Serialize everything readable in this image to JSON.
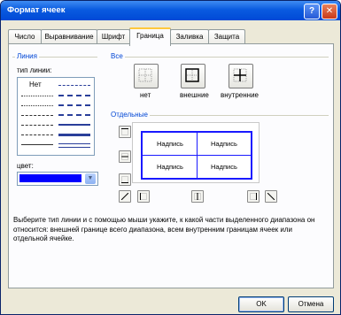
{
  "window": {
    "title": "Формат ячеек",
    "help_glyph": "?",
    "close_glyph": "✕"
  },
  "tabs": [
    {
      "label": "Число"
    },
    {
      "label": "Выравнивание"
    },
    {
      "label": "Шрифт"
    },
    {
      "label": "Граница",
      "active": true
    },
    {
      "label": "Заливка"
    },
    {
      "label": "Защита"
    }
  ],
  "line_group": {
    "legend": "Линия",
    "type_label": "тип линии:",
    "none_label": "Нет",
    "color_label": "цвет:",
    "color_value": "#0000ff"
  },
  "all_group": {
    "legend": "Все",
    "presets": [
      {
        "label": "нет",
        "icon": "border-none-icon"
      },
      {
        "label": "внешние",
        "icon": "border-outline-icon"
      },
      {
        "label": "внутренние",
        "icon": "border-inside-icon"
      }
    ]
  },
  "separate_group": {
    "legend": "Отдельные",
    "preview_cells": [
      "Надпись",
      "Надпись",
      "Надпись",
      "Надпись"
    ]
  },
  "description": "Выберите тип линии и с помощью мыши укажите, к какой части выделенного диапазона он относится: внешней границе всего диапазона, всем внутренним границам ячеек или отдельной ячейке.",
  "buttons": {
    "ok": "OK",
    "cancel": "Отмена"
  },
  "colors": {
    "title_bar": "#0054e3",
    "border_color": "#0000ff",
    "tab_highlight": "#ffc83c",
    "legend_text": "#0046d5"
  }
}
